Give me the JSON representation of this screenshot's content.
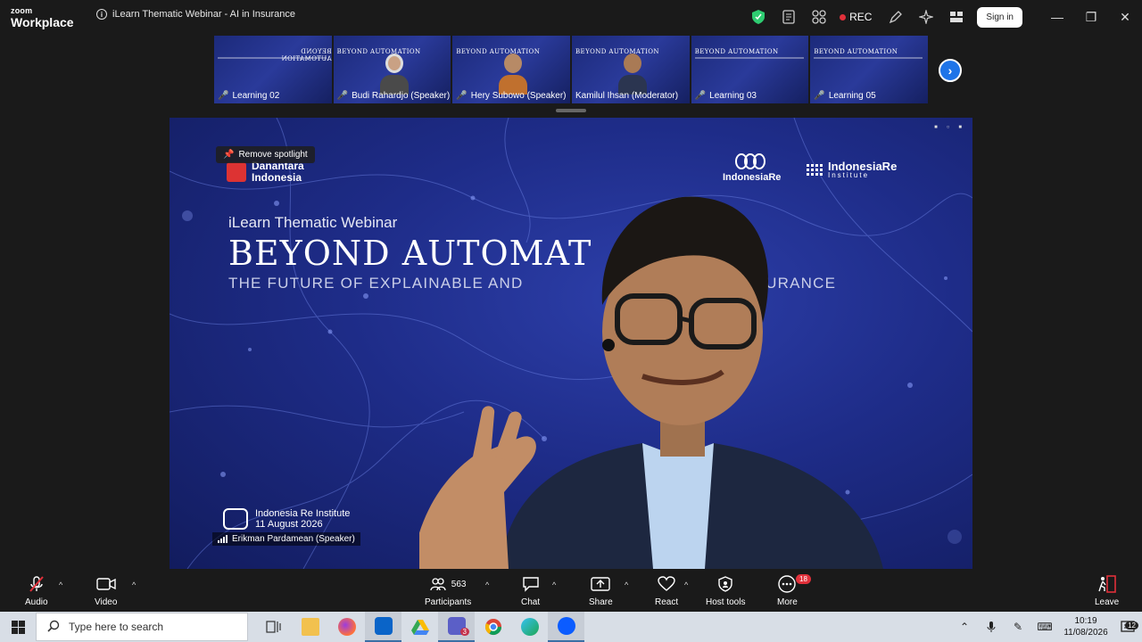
{
  "app": {
    "brand_small": "zoom",
    "brand_big": "Workplace",
    "meeting_title": "iLearn Thematic Webinar - AI in Insurance",
    "rec_label": "REC",
    "signin_label": "Sign in"
  },
  "colors": {
    "accent": "#1e74e8",
    "rec": "#e0303a",
    "shield": "#2ecc71",
    "slide_bg": "#1e2c88"
  },
  "thumbnails": [
    {
      "label": "Learning 02",
      "muted": true
    },
    {
      "label": "Budi Rahardjo (Speaker)",
      "muted": true
    },
    {
      "label": "Hery Subowo (Speaker)",
      "muted": true
    },
    {
      "label": "Kamilul Ihsan (Moderator)",
      "muted": false
    },
    {
      "label": "Learning 03",
      "muted": true
    },
    {
      "label": "Learning 05",
      "muted": true
    }
  ],
  "thumb_slide": {
    "title": "BEYOND AUTOMATION"
  },
  "main": {
    "spotlight_label": "Remove spotlight",
    "danantara_line1": "Danantara",
    "danantara_line2": "Indonesia",
    "indonesiare": "IndonesiaRe",
    "institute_name": "IndonesiaRe",
    "institute_sub": "Institute",
    "webinar_sub": "iLearn Thematic Webinar",
    "webinar_title": "BEYOND AUTOMAT",
    "webinar_line_left": "THE FUTURE OF EXPLAINABLE AND",
    "webinar_line_right": "AI IN INSURANCE",
    "org_name": "Indonesia Re Institute",
    "org_date": "11 August 2026",
    "speaker_name": "Erikman Pardamean (Speaker)"
  },
  "toolbar": {
    "audio": "Audio",
    "video": "Video",
    "participants": "Participants",
    "participants_count": "563",
    "chat": "Chat",
    "share": "Share",
    "react": "React",
    "host_tools": "Host tools",
    "more": "More",
    "more_badge": "18",
    "leave": "Leave"
  },
  "taskbar": {
    "search_placeholder": "Type here to search",
    "time": "10:19",
    "date": "11/08/2026",
    "notifications": "12",
    "teams_badge": "3"
  }
}
